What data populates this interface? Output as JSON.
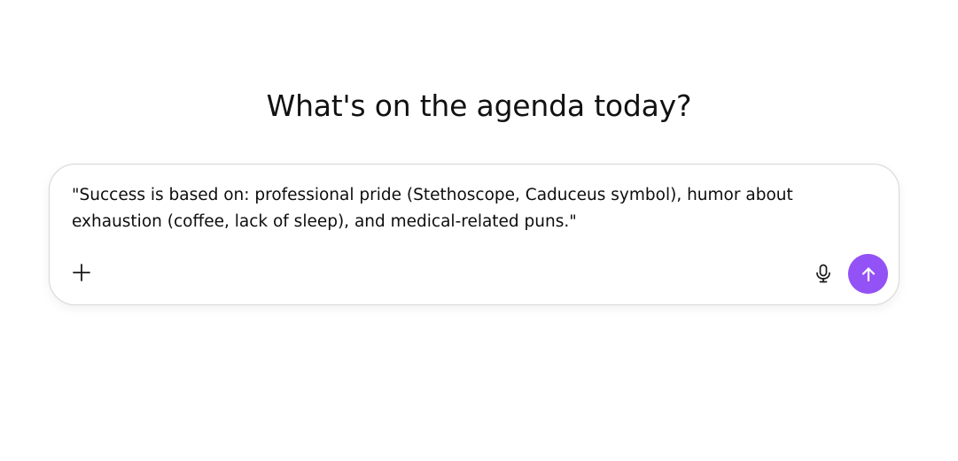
{
  "heading": "What's on the agenda today?",
  "composer": {
    "prompt_text": "\"Success is based on: professional pride (Stethoscope, Caduceus symbol), humor about exhaustion (coffee, lack of sleep), and medical-related puns.\"",
    "buttons": {
      "add": {
        "icon": "plus-icon"
      },
      "voice": {
        "icon": "microphone-icon"
      },
      "send": {
        "icon": "arrow-up-icon"
      }
    }
  },
  "colors": {
    "send_button": "#9352f5",
    "text": "#0d0d0d",
    "border": "#d9d9d9"
  }
}
